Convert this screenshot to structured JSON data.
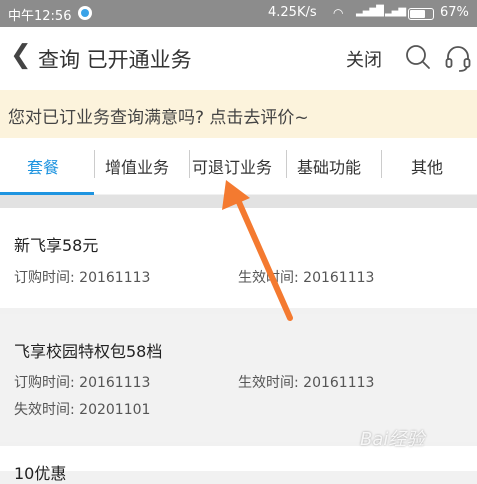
{
  "status_bar": {
    "time": "中午12:56",
    "speed": "4.25K/s",
    "battery": "67%"
  },
  "header": {
    "back_icon": "chevron-left-icon",
    "title": "查询 已开通业务",
    "close_label": "关闭",
    "search_icon": "search-icon",
    "service_icon": "headset-icon"
  },
  "banner": {
    "text": "您对已订业务查询满意吗? 点击去评价~"
  },
  "tabs": {
    "active_color": "#1e94e0",
    "items": [
      {
        "label": "套餐"
      },
      {
        "label": "增值业务"
      },
      {
        "label": "可退订业务"
      },
      {
        "label": "基础功能"
      },
      {
        "label": "其他"
      }
    ]
  },
  "packages": [
    {
      "name": "新飞享58元",
      "order_label": "订购时间: ",
      "order_value": "20161113",
      "effective_label": "生效时间: ",
      "effective_value": "20161113"
    },
    {
      "name": "飞享校园特权包58档",
      "order_label": "订购时间: ",
      "order_value": "20161113",
      "effective_label": "生效时间: ",
      "effective_value": "20161113",
      "expire_label": "失效时间: ",
      "expire_value": "20201101"
    },
    {
      "name": "10优惠"
    }
  ],
  "annotation": {
    "arrow_color": "#f47a30"
  },
  "watermark": {
    "text": "Bai经验"
  }
}
